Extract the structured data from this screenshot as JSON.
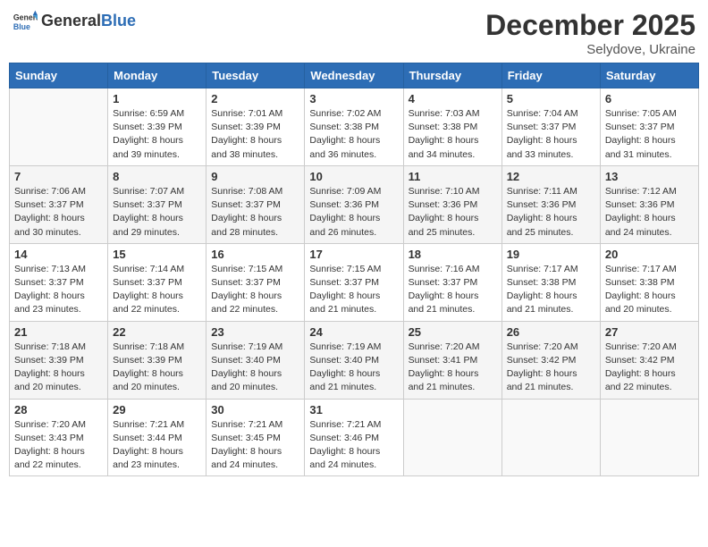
{
  "header": {
    "logo_general": "General",
    "logo_blue": "Blue",
    "month_title": "December 2025",
    "location": "Selydove, Ukraine"
  },
  "days_of_week": [
    "Sunday",
    "Monday",
    "Tuesday",
    "Wednesday",
    "Thursday",
    "Friday",
    "Saturday"
  ],
  "weeks": [
    [
      {
        "day": "",
        "info": ""
      },
      {
        "day": "1",
        "info": "Sunrise: 6:59 AM\nSunset: 3:39 PM\nDaylight: 8 hours\nand 39 minutes."
      },
      {
        "day": "2",
        "info": "Sunrise: 7:01 AM\nSunset: 3:39 PM\nDaylight: 8 hours\nand 38 minutes."
      },
      {
        "day": "3",
        "info": "Sunrise: 7:02 AM\nSunset: 3:38 PM\nDaylight: 8 hours\nand 36 minutes."
      },
      {
        "day": "4",
        "info": "Sunrise: 7:03 AM\nSunset: 3:38 PM\nDaylight: 8 hours\nand 34 minutes."
      },
      {
        "day": "5",
        "info": "Sunrise: 7:04 AM\nSunset: 3:37 PM\nDaylight: 8 hours\nand 33 minutes."
      },
      {
        "day": "6",
        "info": "Sunrise: 7:05 AM\nSunset: 3:37 PM\nDaylight: 8 hours\nand 31 minutes."
      }
    ],
    [
      {
        "day": "7",
        "info": "Sunrise: 7:06 AM\nSunset: 3:37 PM\nDaylight: 8 hours\nand 30 minutes."
      },
      {
        "day": "8",
        "info": "Sunrise: 7:07 AM\nSunset: 3:37 PM\nDaylight: 8 hours\nand 29 minutes."
      },
      {
        "day": "9",
        "info": "Sunrise: 7:08 AM\nSunset: 3:37 PM\nDaylight: 8 hours\nand 28 minutes."
      },
      {
        "day": "10",
        "info": "Sunrise: 7:09 AM\nSunset: 3:36 PM\nDaylight: 8 hours\nand 26 minutes."
      },
      {
        "day": "11",
        "info": "Sunrise: 7:10 AM\nSunset: 3:36 PM\nDaylight: 8 hours\nand 25 minutes."
      },
      {
        "day": "12",
        "info": "Sunrise: 7:11 AM\nSunset: 3:36 PM\nDaylight: 8 hours\nand 25 minutes."
      },
      {
        "day": "13",
        "info": "Sunrise: 7:12 AM\nSunset: 3:36 PM\nDaylight: 8 hours\nand 24 minutes."
      }
    ],
    [
      {
        "day": "14",
        "info": "Sunrise: 7:13 AM\nSunset: 3:37 PM\nDaylight: 8 hours\nand 23 minutes."
      },
      {
        "day": "15",
        "info": "Sunrise: 7:14 AM\nSunset: 3:37 PM\nDaylight: 8 hours\nand 22 minutes."
      },
      {
        "day": "16",
        "info": "Sunrise: 7:15 AM\nSunset: 3:37 PM\nDaylight: 8 hours\nand 22 minutes."
      },
      {
        "day": "17",
        "info": "Sunrise: 7:15 AM\nSunset: 3:37 PM\nDaylight: 8 hours\nand 21 minutes."
      },
      {
        "day": "18",
        "info": "Sunrise: 7:16 AM\nSunset: 3:37 PM\nDaylight: 8 hours\nand 21 minutes."
      },
      {
        "day": "19",
        "info": "Sunrise: 7:17 AM\nSunset: 3:38 PM\nDaylight: 8 hours\nand 21 minutes."
      },
      {
        "day": "20",
        "info": "Sunrise: 7:17 AM\nSunset: 3:38 PM\nDaylight: 8 hours\nand 20 minutes."
      }
    ],
    [
      {
        "day": "21",
        "info": "Sunrise: 7:18 AM\nSunset: 3:39 PM\nDaylight: 8 hours\nand 20 minutes."
      },
      {
        "day": "22",
        "info": "Sunrise: 7:18 AM\nSunset: 3:39 PM\nDaylight: 8 hours\nand 20 minutes."
      },
      {
        "day": "23",
        "info": "Sunrise: 7:19 AM\nSunset: 3:40 PM\nDaylight: 8 hours\nand 20 minutes."
      },
      {
        "day": "24",
        "info": "Sunrise: 7:19 AM\nSunset: 3:40 PM\nDaylight: 8 hours\nand 21 minutes."
      },
      {
        "day": "25",
        "info": "Sunrise: 7:20 AM\nSunset: 3:41 PM\nDaylight: 8 hours\nand 21 minutes."
      },
      {
        "day": "26",
        "info": "Sunrise: 7:20 AM\nSunset: 3:42 PM\nDaylight: 8 hours\nand 21 minutes."
      },
      {
        "day": "27",
        "info": "Sunrise: 7:20 AM\nSunset: 3:42 PM\nDaylight: 8 hours\nand 22 minutes."
      }
    ],
    [
      {
        "day": "28",
        "info": "Sunrise: 7:20 AM\nSunset: 3:43 PM\nDaylight: 8 hours\nand 22 minutes."
      },
      {
        "day": "29",
        "info": "Sunrise: 7:21 AM\nSunset: 3:44 PM\nDaylight: 8 hours\nand 23 minutes."
      },
      {
        "day": "30",
        "info": "Sunrise: 7:21 AM\nSunset: 3:45 PM\nDaylight: 8 hours\nand 24 minutes."
      },
      {
        "day": "31",
        "info": "Sunrise: 7:21 AM\nSunset: 3:46 PM\nDaylight: 8 hours\nand 24 minutes."
      },
      {
        "day": "",
        "info": ""
      },
      {
        "day": "",
        "info": ""
      },
      {
        "day": "",
        "info": ""
      }
    ]
  ]
}
